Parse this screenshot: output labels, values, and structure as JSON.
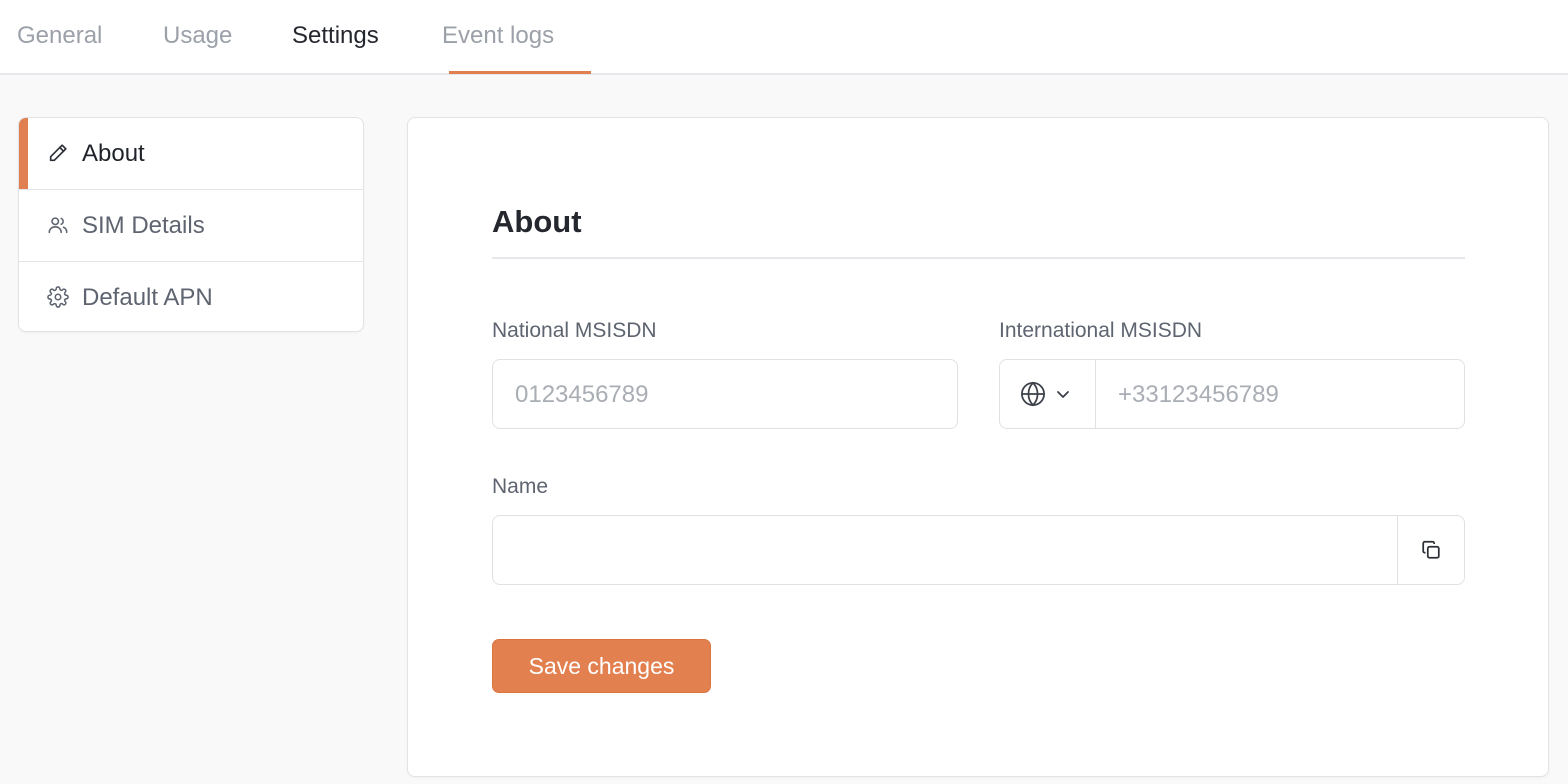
{
  "tabs": [
    {
      "label": "General"
    },
    {
      "label": "Usage"
    },
    {
      "label": "Settings"
    },
    {
      "label": "Event logs"
    }
  ],
  "sidebar": {
    "items": [
      {
        "label": "About",
        "icon": "pencil-icon",
        "active": true
      },
      {
        "label": "SIM Details",
        "icon": "users-icon"
      },
      {
        "label": "Default APN",
        "icon": "gear-icon"
      }
    ]
  },
  "main": {
    "title": "About",
    "national_msisdn": {
      "label": "National MSISDN",
      "placeholder": "0123456789",
      "value": ""
    },
    "international_msisdn": {
      "label": "International MSISDN",
      "placeholder": "+33123456789",
      "value": "",
      "country_icon": "globe-icon"
    },
    "name": {
      "label": "Name",
      "value": ""
    },
    "save_label": "Save changes"
  },
  "colors": {
    "accent": "#e07f50",
    "button": "#e3804f"
  }
}
